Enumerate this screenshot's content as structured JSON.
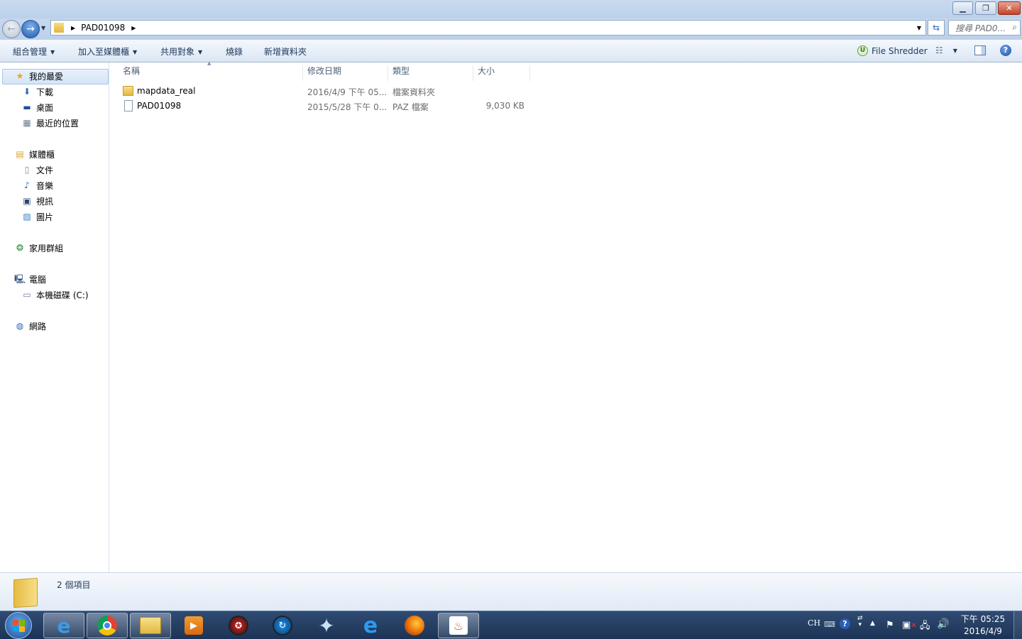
{
  "window": {
    "min_icon": "minimize-icon",
    "restore_icon": "restore-icon",
    "close_icon": "close-icon"
  },
  "address": {
    "path_label": "PAD01098",
    "search_placeholder": "搜尋 PAD0..."
  },
  "toolbar": {
    "organize": "組合管理",
    "add_to_library": "加入至媒體櫃",
    "share": "共用對象",
    "burn": "燒錄",
    "new_folder": "新增資料夾",
    "file_shredder": "File Shredder"
  },
  "sidebar": {
    "favorites": "我的最愛",
    "downloads": "下載",
    "desktop": "桌面",
    "recent": "最近的位置",
    "libraries": "媒體櫃",
    "documents": "文件",
    "music": "音樂",
    "videos": "視訊",
    "pictures": "圖片",
    "homegroup": "家用群組",
    "computer": "電腦",
    "local_disk": "本機磁碟 (C:)",
    "network": "網路"
  },
  "columns": {
    "name": "名稱",
    "date": "修改日期",
    "type": "類型",
    "size": "大小"
  },
  "files": [
    {
      "name": "mapdata_real",
      "date": "2016/4/9 下午 05...",
      "type": "檔案資料夾",
      "size": "",
      "icon": "folder-icon"
    },
    {
      "name": "PAD01098",
      "date": "2015/5/28 下午 0...",
      "type": "PAZ 檔案",
      "size": "9,030 KB",
      "icon": "file-icon"
    }
  ],
  "details": {
    "item_count": "2 個項目"
  },
  "tray": {
    "lang": "CH",
    "time": "下午 05:25",
    "date": "2016/4/9"
  },
  "colors": {
    "accent": "#3a6ea5",
    "taskbar": "#1c3355",
    "folder": "#e8c358"
  }
}
